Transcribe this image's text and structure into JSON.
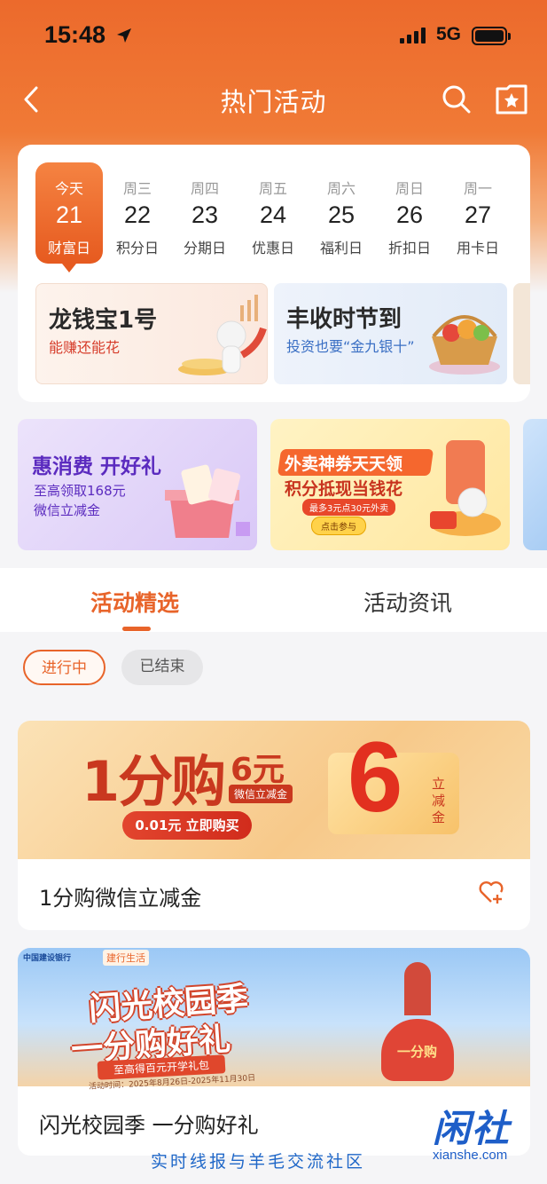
{
  "status": {
    "time": "15:48",
    "network": "5G"
  },
  "nav": {
    "title": "热门活动"
  },
  "calendar": [
    {
      "weekday": "今天",
      "date": "21",
      "tag": "财富日",
      "active": true
    },
    {
      "weekday": "周三",
      "date": "22",
      "tag": "积分日"
    },
    {
      "weekday": "周四",
      "date": "23",
      "tag": "分期日"
    },
    {
      "weekday": "周五",
      "date": "24",
      "tag": "优惠日"
    },
    {
      "weekday": "周六",
      "date": "25",
      "tag": "福利日"
    },
    {
      "weekday": "周日",
      "date": "26",
      "tag": "折扣日"
    },
    {
      "weekday": "周一",
      "date": "27",
      "tag": "用卡日"
    }
  ],
  "promos": [
    {
      "title": "龙钱宝1号",
      "subtitle": "能赚还能花"
    },
    {
      "title": "丰收时节到",
      "subtitle": "投资也要“金九银十”"
    }
  ],
  "banners": [
    {
      "title": "惠消费 开好礼",
      "line1": "至高领取168元",
      "line2": "微信立减金"
    },
    {
      "title1": "外卖神券天天领",
      "title2": "积分抵现当钱花",
      "note": "最多3元点30元外卖",
      "button": "点击参与"
    }
  ],
  "tabs": [
    {
      "label": "活动精选"
    },
    {
      "label": "活动资讯"
    }
  ],
  "filters": [
    {
      "label": "进行中"
    },
    {
      "label": "已结束"
    }
  ],
  "cards": [
    {
      "banner": {
        "big": "1分购",
        "amount": "6元",
        "sub": "微信立减金",
        "button": "0.01元 立即购买",
        "ticket_num": "6",
        "ticket_text1": "立",
        "ticket_text2": "减",
        "ticket_text3": "金"
      },
      "title": "1分购微信立减金"
    },
    {
      "banner": {
        "bank": "中国建设银行",
        "app": "建行生活",
        "line1": "闪光校园季",
        "line2": "一分购好礼",
        "ribbon": "至高得百元开学礼包",
        "period": "活动时间：2025年8月26日-2025年11月30日",
        "bag": "一分购"
      },
      "title": "闪光校园季 一分购好礼"
    }
  ],
  "watermark": {
    "text": "实时线报与羊毛交流社区",
    "logo": "闲社",
    "domain": "xianshe.com"
  }
}
